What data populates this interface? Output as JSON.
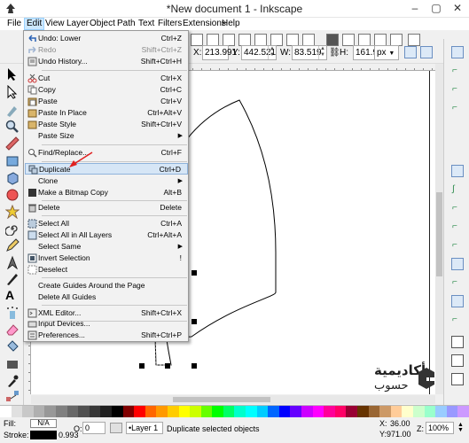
{
  "window": {
    "title": "*New document 1 - Inkscape",
    "buttons": [
      "–",
      "▢",
      "✕"
    ]
  },
  "menubar": {
    "items": [
      "File",
      "Edit",
      "View",
      "Layer",
      "Object",
      "Path",
      "Text",
      "Filters",
      "Extensions",
      "Help"
    ],
    "active": "Edit"
  },
  "toolbar": {
    "x_label": "X:",
    "x_value": "213.991",
    "y_label": "Y:",
    "y_value": "442.521",
    "w_label": "W:",
    "w_value": "83.519",
    "h_label": "H:",
    "h_value": "161.963",
    "unit": "px"
  },
  "edit_menu": {
    "items": [
      {
        "label": "Undo: Lower",
        "shortcut": "Ctrl+Z"
      },
      {
        "label": "Redo",
        "shortcut": "Shift+Ctrl+Z"
      },
      {
        "label": "Undo History...",
        "shortcut": "Shift+Ctrl+H"
      },
      {
        "label": "Cut",
        "shortcut": "Ctrl+X"
      },
      {
        "label": "Copy",
        "shortcut": "Ctrl+C"
      },
      {
        "label": "Paste",
        "shortcut": "Ctrl+V"
      },
      {
        "label": "Paste In Place",
        "shortcut": "Ctrl+Alt+V"
      },
      {
        "label": "Paste Style",
        "shortcut": "Shift+Ctrl+V"
      },
      {
        "label": "Paste Size",
        "shortcut": ""
      },
      {
        "label": "Find/Replace...",
        "shortcut": "Ctrl+F"
      },
      {
        "label": "Duplicate",
        "shortcut": "Ctrl+D"
      },
      {
        "label": "Clone",
        "shortcut": ""
      },
      {
        "label": "Make a Bitmap Copy",
        "shortcut": "Alt+B"
      },
      {
        "label": "Delete",
        "shortcut": "Delete"
      },
      {
        "label": "Select All",
        "shortcut": "Ctrl+A"
      },
      {
        "label": "Select All in All Layers",
        "shortcut": "Ctrl+Alt+A"
      },
      {
        "label": "Select Same",
        "shortcut": ""
      },
      {
        "label": "Invert Selection",
        "shortcut": "!"
      },
      {
        "label": "Deselect",
        "shortcut": ""
      },
      {
        "label": "Create Guides Around the Page",
        "shortcut": ""
      },
      {
        "label": "Delete All Guides",
        "shortcut": ""
      },
      {
        "label": "XML Editor...",
        "shortcut": "Shift+Ctrl+X"
      },
      {
        "label": "Input Devices...",
        "shortcut": ""
      },
      {
        "label": "Preferences...",
        "shortcut": "Shift+Ctrl+P"
      }
    ],
    "highlighted": "Duplicate"
  },
  "status": {
    "fill_label": "Fill:",
    "fill_value": "N/A",
    "stroke_label": "Stroke:",
    "stroke_value": "0.993",
    "opacity_label": "O:",
    "opacity_value": "0",
    "layer": "•Layer 1",
    "message": "Duplicate selected objects",
    "x_label": "X:",
    "x_value": "36.00",
    "y_label": "Y:",
    "y_value": "971.00",
    "z_label": "Z:",
    "zoom": "100%"
  },
  "watermark": {
    "arabic_line1": "أكاديمية",
    "arabic_line2": "حسوب"
  },
  "colors": {
    "highlight": "#d6e6f6",
    "menu_active": "#cce8ff",
    "arrow": "#e02020"
  }
}
